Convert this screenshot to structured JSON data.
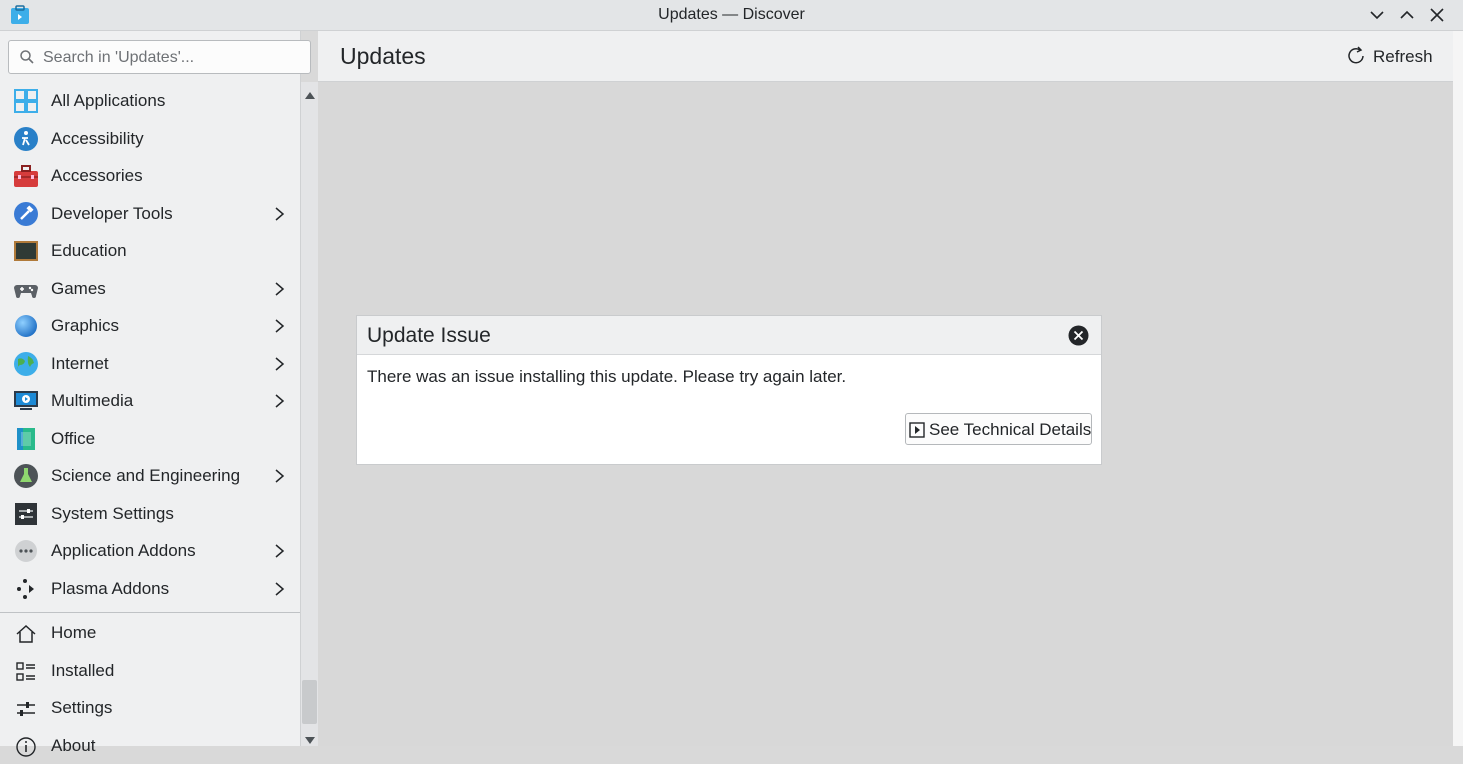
{
  "window": {
    "title": "Updates — Discover"
  },
  "search": {
    "placeholder": "Search in 'Updates'..."
  },
  "sidebar": {
    "categories": [
      {
        "label": "All Applications",
        "icon": "grid-icon",
        "has_submenu": false
      },
      {
        "label": "Accessibility",
        "icon": "accessibility-icon",
        "has_submenu": false
      },
      {
        "label": "Accessories",
        "icon": "toolbox-icon",
        "has_submenu": false
      },
      {
        "label": "Developer Tools",
        "icon": "hammer-icon",
        "has_submenu": true
      },
      {
        "label": "Education",
        "icon": "chalkboard-icon",
        "has_submenu": false
      },
      {
        "label": "Games",
        "icon": "gamepad-icon",
        "has_submenu": true
      },
      {
        "label": "Graphics",
        "icon": "sphere-icon",
        "has_submenu": true
      },
      {
        "label": "Internet",
        "icon": "globe-icon",
        "has_submenu": true
      },
      {
        "label": "Multimedia",
        "icon": "monitor-play-icon",
        "has_submenu": true
      },
      {
        "label": "Office",
        "icon": "document-icon",
        "has_submenu": false
      },
      {
        "label": "Science and Engineering",
        "icon": "flask-icon",
        "has_submenu": true
      },
      {
        "label": "System Settings",
        "icon": "settings-panel-icon",
        "has_submenu": false
      },
      {
        "label": "Application Addons",
        "icon": "more-dots-icon",
        "has_submenu": true
      },
      {
        "label": "Plasma Addons",
        "icon": "plasma-icon",
        "has_submenu": true
      }
    ],
    "bottom": [
      {
        "label": "Home",
        "icon": "home-icon"
      },
      {
        "label": "Installed",
        "icon": "installed-list-icon"
      },
      {
        "label": "Settings",
        "icon": "sliders-icon"
      },
      {
        "label": "About",
        "icon": "info-icon"
      }
    ]
  },
  "header": {
    "title": "Updates",
    "refresh_label": "Refresh"
  },
  "dialog": {
    "title": "Update Issue",
    "message": "There was an issue installing this update. Please try again later.",
    "details_button": "See Technical Details"
  },
  "colors": {
    "accent": "#3daee9",
    "window_bg": "#eff0f1",
    "overlay_bg": "#d8d8d8"
  }
}
